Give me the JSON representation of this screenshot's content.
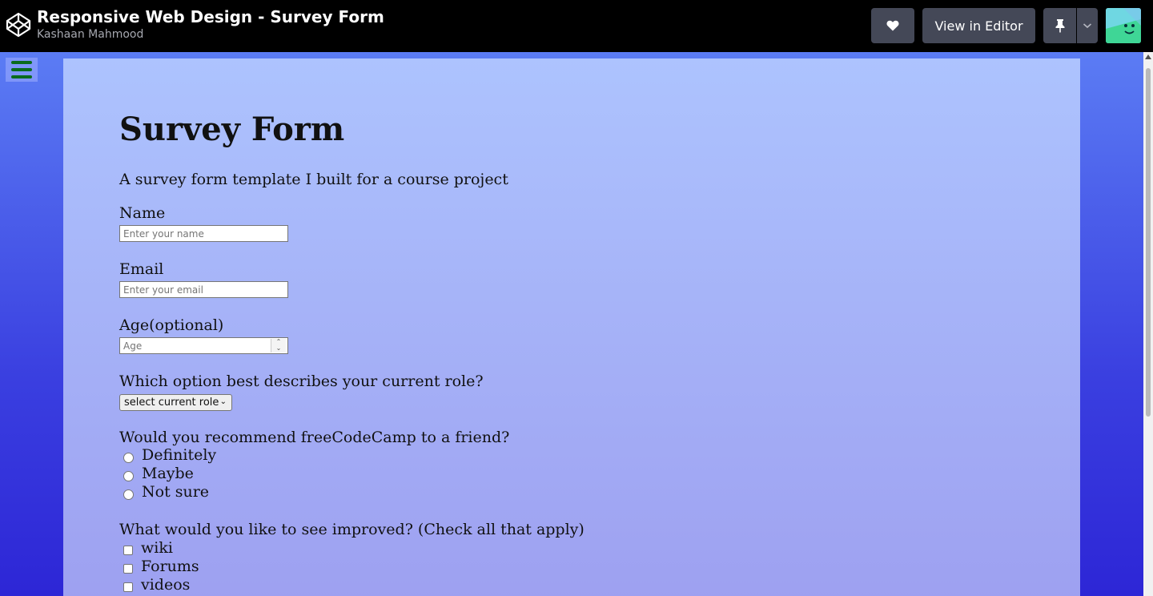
{
  "header": {
    "title": "Responsive Web Design - Survey Form",
    "author": "Kashaan Mahmood",
    "view_in_editor": "View in Editor",
    "icons": {
      "logo": "codepen-logo-icon",
      "like": "heart-icon",
      "pin": "pin-icon",
      "dropdown": "chevron-down-icon"
    }
  },
  "form": {
    "heading": "Survey Form",
    "description": "A survey form template I built for a course project",
    "name_label": "Name",
    "name_placeholder": "Enter your name",
    "email_label": "Email",
    "email_placeholder": "Enter your email",
    "age_label": "Age(optional)",
    "age_placeholder": "Age",
    "role_label": "Which option best describes your current role?",
    "role_selected": "select current role",
    "recommend_label": "Would you recommend freeCodeCamp to a friend?",
    "recommend_options": [
      "Definitely",
      "Maybe",
      "Not sure"
    ],
    "improve_label": "What would you like to see improved? (Check all that apply)",
    "improve_options": [
      "wiki",
      "Forums",
      "videos"
    ]
  },
  "colors": {
    "topbar": "#000000",
    "button": "#444857",
    "page_gradient_top": "#5b7cf4",
    "page_gradient_bottom": "#2d26d6",
    "card_top": "#adc3fe",
    "card_bottom": "#9d9ff0",
    "menu_lines": "#0a6b1f"
  }
}
